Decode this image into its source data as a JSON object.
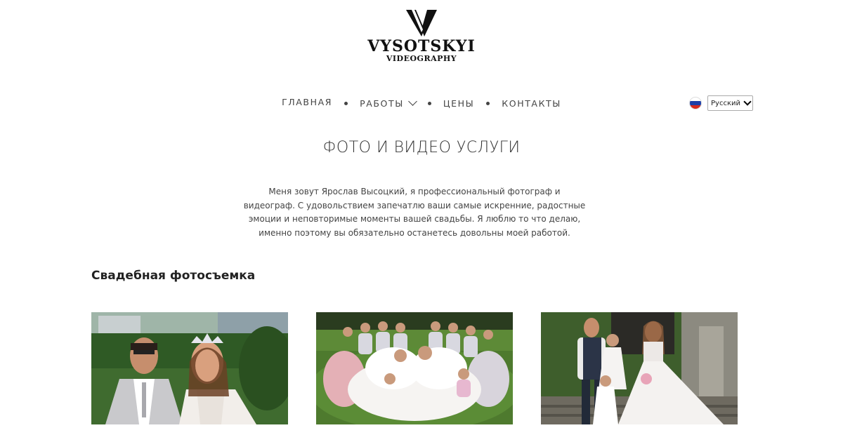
{
  "logo": {
    "name": "VYSOTSKYI",
    "subtitle": "VIDEOGRAPHY"
  },
  "nav": {
    "items": [
      "ГЛАВНАЯ",
      "РАБОТЫ",
      "ЦЕНЫ",
      "КОНТАКТЫ"
    ]
  },
  "language": {
    "selected": "Русский",
    "flag": "russia-flag"
  },
  "page_title": "ФОТО И ВИДЕО УСЛУГИ",
  "intro_text": "Меня зовут Ярослав Высоцкий, я профессиональный фотограф и видеограф. С удовольствием запечатлю ваши самые искренние, радостные эмоции и неповторимые моменты вашей свадьбы. Я люблю то что делаю, именно поэтому вы обязательно останетесь довольны моей работой.",
  "section": {
    "title": "Свадебная фотосъемка"
  },
  "gallery": [
    {
      "name": "wedding-couple-photo"
    },
    {
      "name": "bride-with-bridesmaids-photo"
    },
    {
      "name": "wedding-family-photo"
    }
  ]
}
